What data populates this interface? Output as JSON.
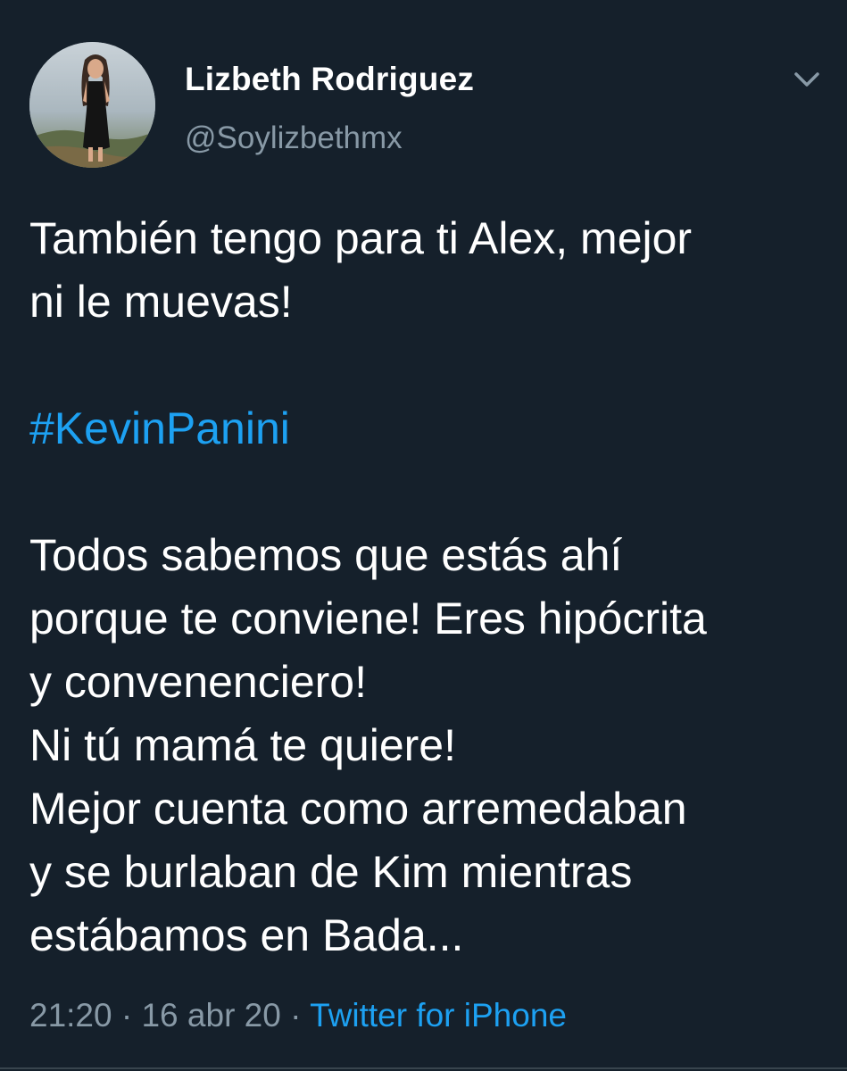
{
  "tweet": {
    "author": {
      "display_name": "Lizbeth Rodriguez",
      "handle": "@Soylizbethmx"
    },
    "body": {
      "paragraph1": [
        "También tengo para ti Alex, mejor",
        "ni le muevas!"
      ],
      "hashtag": "#KevinPanini",
      "paragraph2": [
        "Todos sabemos que estás ahí",
        "porque te conviene! Eres hipócrita",
        "y convenenciero!",
        "Ni tú mamá te quiere!",
        "Mejor cuenta como arremedaban",
        "y se burlaban de Kim mientras",
        "estábamos en Bada..."
      ]
    },
    "meta": {
      "time": "21:20",
      "separator": " · ",
      "date": "16 abr 20",
      "source": "Twitter for iPhone"
    }
  },
  "icons": {
    "caret": "chevron-down-icon",
    "avatar": "profile-photo"
  },
  "colors": {
    "background": "#15202b",
    "text": "#ffffff",
    "secondary_text": "#8899a6",
    "link": "#1da1f2",
    "divider": "#38444d"
  }
}
